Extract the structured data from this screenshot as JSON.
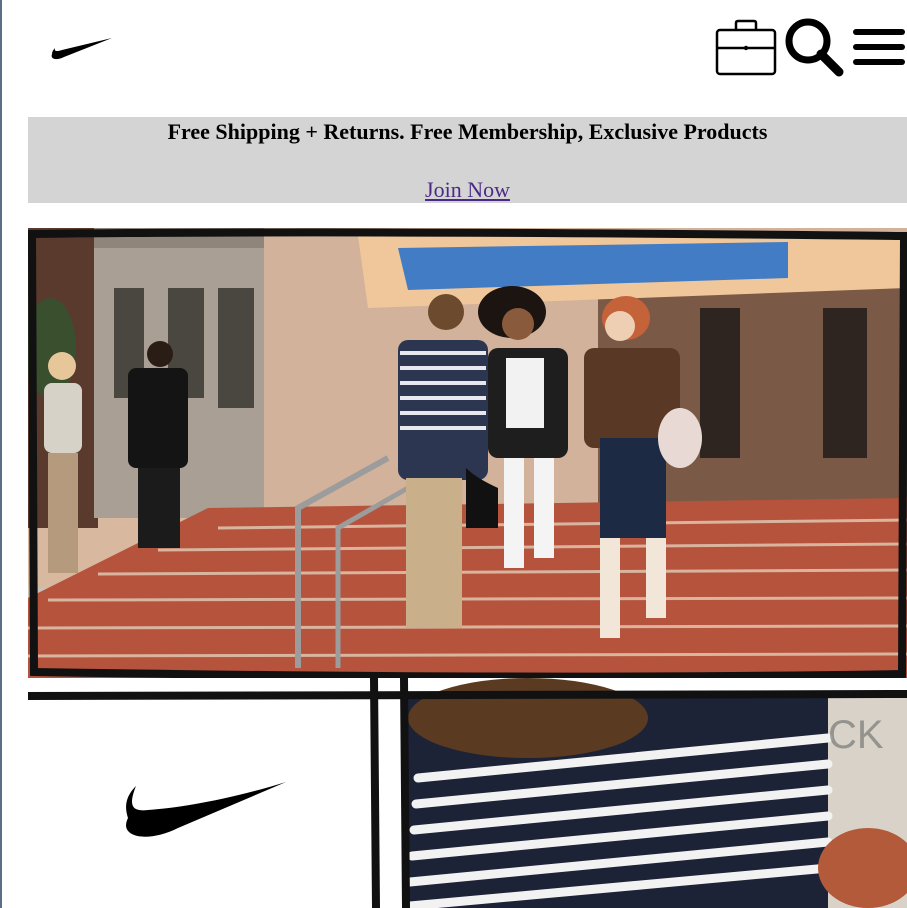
{
  "header": {
    "logo_name": "swoosh-logo",
    "icons": [
      "briefcase-icon",
      "search-icon",
      "menu-icon"
    ]
  },
  "banner": {
    "text": "Free Shipping + Returns. Free Membership, Exclusive Products",
    "link_label": "Join Now"
  },
  "colors": {
    "banner_bg": "#d4d4d4",
    "link": "#4b2a85",
    "text": "#000000"
  }
}
